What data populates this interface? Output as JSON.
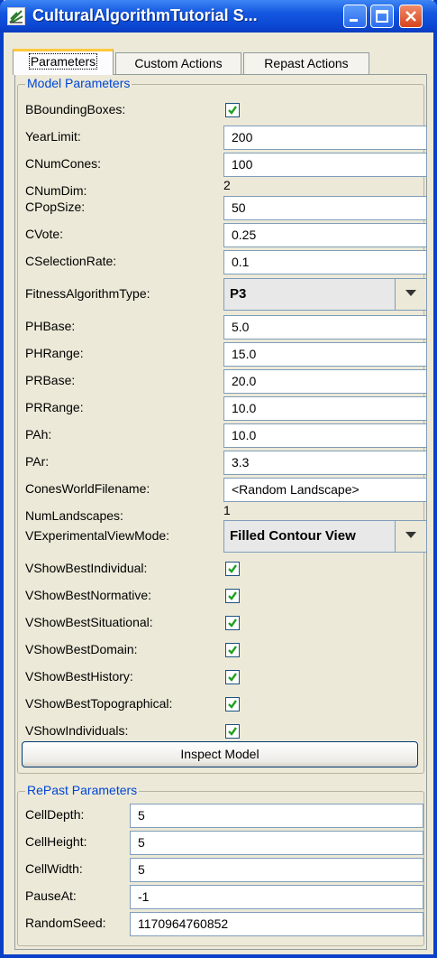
{
  "window": {
    "title": "CulturalAlgorithmTutorial S..."
  },
  "tabs": [
    "Parameters",
    "Custom Actions",
    "Repast Actions"
  ],
  "model": {
    "legend": "Model Parameters",
    "rows": [
      {
        "label": "BBoundingBoxes:",
        "type": "check",
        "checked": true
      },
      {
        "label": "YearLimit:",
        "type": "text",
        "value": "200"
      },
      {
        "label": "CNumCones:",
        "type": "text",
        "value": "100"
      },
      {
        "label": "CNumDim:",
        "type": "static",
        "value": "2"
      },
      {
        "label": "CPopSize:",
        "type": "text",
        "value": "50"
      },
      {
        "label": "CVote:",
        "type": "text",
        "value": "0.25"
      },
      {
        "label": "CSelectionRate:",
        "type": "text",
        "value": "0.1"
      },
      {
        "label": "FitnessAlgorithmType:",
        "type": "combo",
        "value": "P3"
      },
      {
        "label": "PHBase:",
        "type": "text",
        "value": "5.0"
      },
      {
        "label": "PHRange:",
        "type": "text",
        "value": "15.0"
      },
      {
        "label": "PRBase:",
        "type": "text",
        "value": "20.0"
      },
      {
        "label": "PRRange:",
        "type": "text",
        "value": "10.0"
      },
      {
        "label": "PAh:",
        "type": "text",
        "value": "10.0"
      },
      {
        "label": "PAr:",
        "type": "text",
        "value": "3.3"
      },
      {
        "label": "ConesWorldFilename:",
        "type": "text",
        "value": "<Random Landscape>"
      },
      {
        "label": "NumLandscapes:",
        "type": "static",
        "value": "1"
      },
      {
        "label": "VExperimentalViewMode:",
        "type": "combo",
        "value": "Filled Contour View"
      },
      {
        "label": "VShowBestIndividual:",
        "type": "check",
        "checked": true
      },
      {
        "label": "VShowBestNormative:",
        "type": "check",
        "checked": true
      },
      {
        "label": "VShowBestSituational:",
        "type": "check",
        "checked": true
      },
      {
        "label": "VShowBestDomain:",
        "type": "check",
        "checked": true
      },
      {
        "label": "VShowBestHistory:",
        "type": "check",
        "checked": true
      },
      {
        "label": "VShowBestTopographical:",
        "type": "check",
        "checked": true
      },
      {
        "label": "VShowIndividuals:",
        "type": "check",
        "checked": true
      }
    ],
    "inspect_button": "Inspect Model"
  },
  "repast": {
    "legend": "RePast Parameters",
    "rows": [
      {
        "label": "CellDepth:",
        "value": "5"
      },
      {
        "label": "CellHeight:",
        "value": "5"
      },
      {
        "label": "CellWidth:",
        "value": "5"
      },
      {
        "label": "PauseAt:",
        "value": "-1"
      },
      {
        "label": "RandomSeed:",
        "value": "1170964760852"
      }
    ]
  }
}
